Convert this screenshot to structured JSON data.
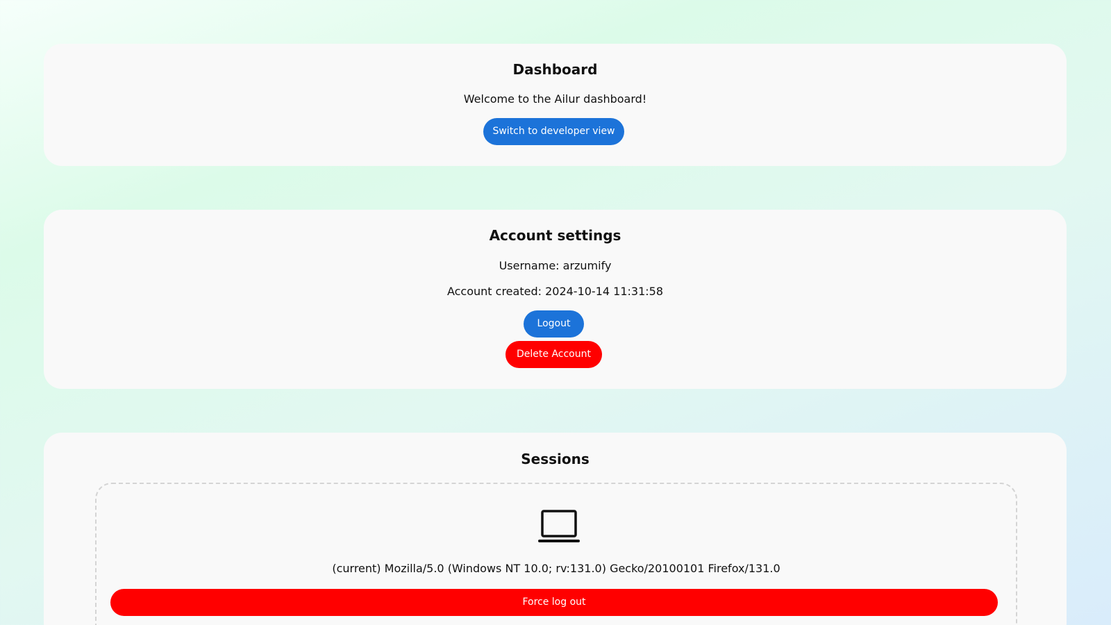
{
  "dashboard": {
    "title": "Dashboard",
    "welcome": "Welcome to the Ailur dashboard!",
    "developer_view_label": "Switch to developer view"
  },
  "account": {
    "title": "Account settings",
    "username_text": "Username: arzumify",
    "created_text": "Account created: 2024-10-14 11:31:58",
    "logout_label": "Logout",
    "delete_label": "Delete Account"
  },
  "sessions": {
    "title": "Sessions",
    "items": [
      {
        "icon": "laptop-icon",
        "agent": "(current) Mozilla/5.0 (Windows NT 10.0; rv:131.0) Gecko/20100101 Firefox/131.0",
        "force_logout_label": "Force log out"
      }
    ]
  },
  "colors": {
    "primary": "#1c73d9",
    "danger": "#ff0000",
    "card": "#f9f9f9"
  }
}
